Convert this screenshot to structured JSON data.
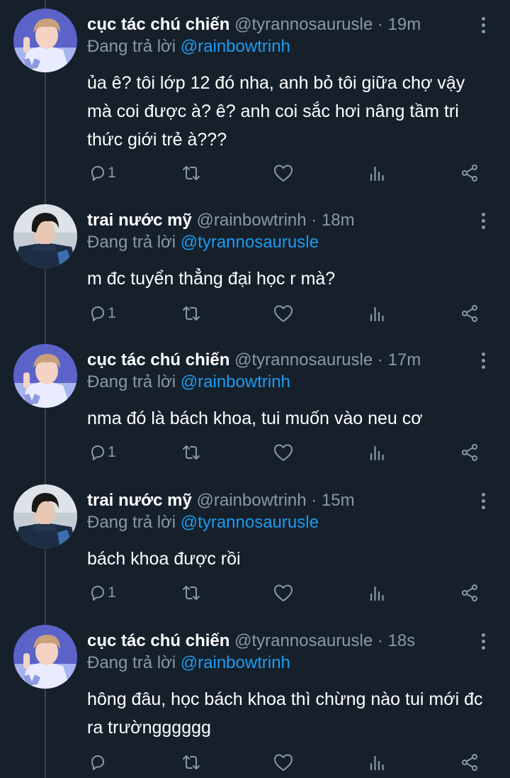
{
  "colors": {
    "background": "#15202b",
    "text": "#ffffff",
    "secondary": "#8b98a5",
    "link": "#1d9bf0",
    "thread_line": "#38444d"
  },
  "tweets": [
    {
      "display_name": "cục tác chú chiến",
      "handle": "@tyrannosaurusle",
      "separator": "·",
      "time": "19m",
      "replying_prefix": "Đang trả lời",
      "replying_to": "@rainbowtrinh",
      "text": "ủa ê? tôi lớp 12 đó nha, anh bỏ tôi giữa chợ vậy mà coi được à? ê? anh coi sắc hơi nâng tầm tri thức giới trẻ à???",
      "reply_count": "1",
      "avatar": "avatar-a"
    },
    {
      "display_name": "trai nước mỹ",
      "handle": "@rainbowtrinh",
      "separator": "·",
      "time": "18m",
      "replying_prefix": "Đang trả lời",
      "replying_to": "@tyrannosaurusle",
      "text": "m đc tuyển thẳng đại học r mà?",
      "reply_count": "1",
      "avatar": "avatar-b"
    },
    {
      "display_name": "cục tác chú chiến",
      "handle": "@tyrannosaurusle",
      "separator": "·",
      "time": "17m",
      "replying_prefix": "Đang trả lời",
      "replying_to": "@rainbowtrinh",
      "text": "nma đó là bách khoa, tui muốn vào neu cơ",
      "reply_count": "1",
      "avatar": "avatar-a"
    },
    {
      "display_name": "trai nước mỹ",
      "handle": "@rainbowtrinh",
      "separator": "·",
      "time": "15m",
      "replying_prefix": "Đang trả lời",
      "replying_to": "@tyrannosaurusle",
      "text": "bách khoa được rồi",
      "reply_count": "1",
      "avatar": "avatar-b"
    },
    {
      "display_name": "cục tác chú chiến",
      "handle": "@tyrannosaurusle",
      "separator": "·",
      "time": "18s",
      "replying_prefix": "Đang trả lời",
      "replying_to": "@rainbowtrinh",
      "text": "hông đâu, học bách khoa thì chừng nào tui mới đc ra trườngggggg",
      "reply_count": "",
      "avatar": "avatar-a"
    }
  ],
  "icons": [
    "reply-icon",
    "retweet-icon",
    "like-icon",
    "analytics-icon",
    "share-icon",
    "more-icon"
  ]
}
